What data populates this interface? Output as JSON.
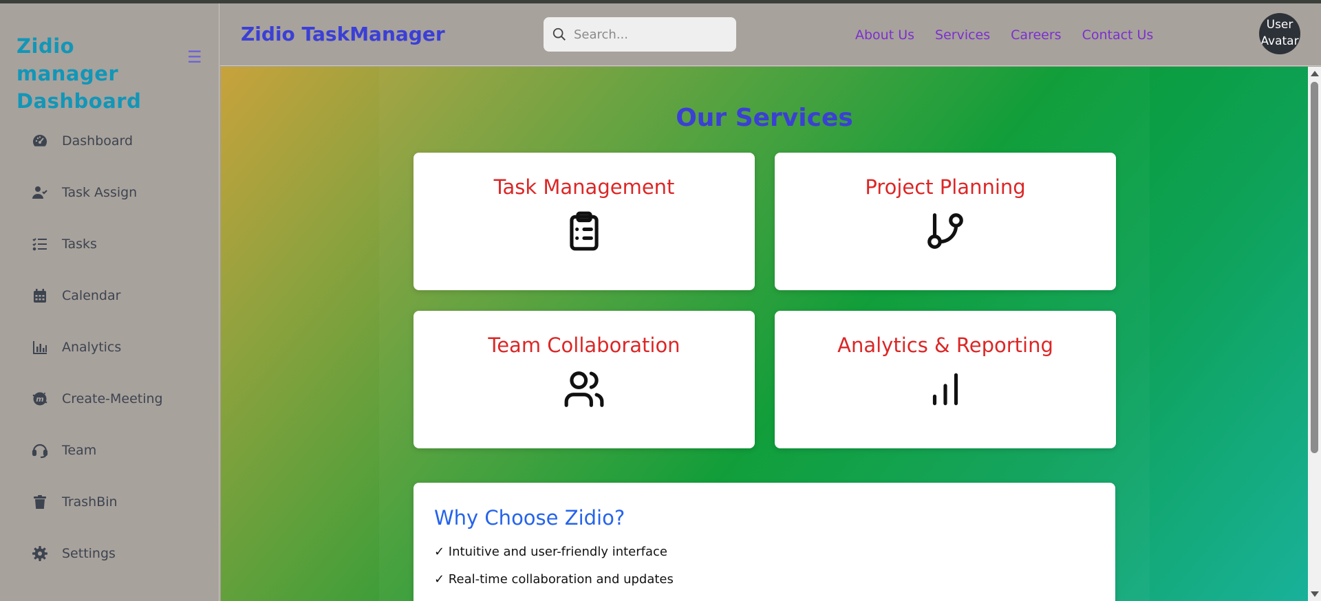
{
  "sidebar": {
    "brand": "Zidio manager Dashboard",
    "menu_icon": "hamburger-icon",
    "items": [
      {
        "label": "Dashboard",
        "icon": "gauge-icon"
      },
      {
        "label": "Task Assign",
        "icon": "user-check-icon"
      },
      {
        "label": "Tasks",
        "icon": "list-check-icon"
      },
      {
        "label": "Calendar",
        "icon": "calendar-icon"
      },
      {
        "label": "Analytics",
        "icon": "bar-chart-icon"
      },
      {
        "label": "Create-Meeting",
        "icon": "meetup-icon"
      },
      {
        "label": "Team",
        "icon": "headset-icon"
      },
      {
        "label": "TrashBin",
        "icon": "trash-icon"
      },
      {
        "label": "Settings",
        "icon": "gear-icon"
      }
    ]
  },
  "header": {
    "title": "Zidio TaskManager",
    "search": {
      "placeholder": "Search...",
      "value": ""
    },
    "links": [
      "About Us",
      "Services",
      "Careers",
      "Contact Us"
    ],
    "avatar_alt": "User Avatar"
  },
  "main": {
    "title": "Our Services",
    "services": [
      {
        "title": "Task Management",
        "icon": "clipboard-list-icon"
      },
      {
        "title": "Project Planning",
        "icon": "git-branch-icon"
      },
      {
        "title": "Team Collaboration",
        "icon": "users-icon"
      },
      {
        "title": "Analytics & Reporting",
        "icon": "signal-bars-icon"
      }
    ],
    "why": {
      "title": "Why Choose Zidio?",
      "points": [
        "✓ Intuitive and user-friendly interface",
        "✓ Real-time collaboration and updates"
      ]
    }
  },
  "colors": {
    "brand": "#1296b8",
    "title": "#3b3fd6",
    "link": "#7b2fcf",
    "card_title": "#dc2626",
    "why_title": "#2563eb",
    "chrome": "#a8a29c"
  }
}
